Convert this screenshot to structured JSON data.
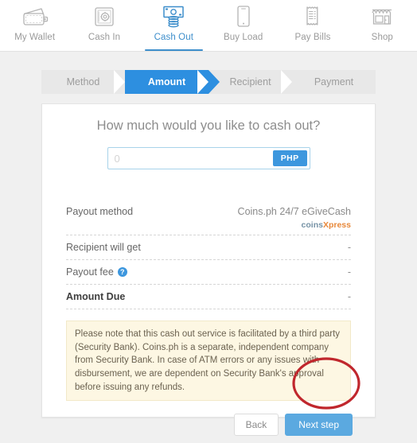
{
  "nav": {
    "items": [
      {
        "label": "My Wallet",
        "icon": "wallet-icon",
        "active": false
      },
      {
        "label": "Cash In",
        "icon": "safe-icon",
        "active": false
      },
      {
        "label": "Cash Out",
        "icon": "cash-out-icon",
        "active": true
      },
      {
        "label": "Buy Load",
        "icon": "mobile-phone-icon",
        "active": false
      },
      {
        "label": "Pay Bills",
        "icon": "receipt-icon",
        "active": false
      },
      {
        "label": "Shop",
        "icon": "storefront-icon",
        "active": false
      }
    ]
  },
  "steps": [
    {
      "label": "Method",
      "active": false
    },
    {
      "label": "Amount",
      "active": true
    },
    {
      "label": "Recipient",
      "active": false
    },
    {
      "label": "Payment",
      "active": false
    }
  ],
  "card": {
    "title": "How much would you like to cash out?",
    "amount_input": {
      "value": "",
      "placeholder": "0"
    },
    "currency_button": "PHP"
  },
  "details": {
    "payout_method": {
      "label": "Payout method",
      "value": "Coins.ph 24/7 eGiveCash",
      "brand_part1": "coins",
      "brand_part2": "Xpress"
    },
    "recipient_will_get": {
      "label": "Recipient will get",
      "value": "-"
    },
    "payout_fee": {
      "label": "Payout fee",
      "value": "-",
      "help_glyph": "?"
    },
    "amount_due": {
      "label": "Amount Due",
      "value": "-"
    }
  },
  "notice": "Please note that this cash out service is facilitated by a third party (Security Bank). Coins.ph is a separate, independent company from Security Bank. In case of ATM errors or any issues with disbursement, we are dependent on Security Bank's approval before issuing any refunds.",
  "actions": {
    "back": "Back",
    "next": "Next step"
  },
  "annotation": {
    "shape": "red-ellipse-highlight",
    "color": "#c0272d",
    "target": "Next step"
  },
  "colors": {
    "accent_blue": "#2d8fe0",
    "nav_active": "#3d8ecb",
    "notice_bg": "#fdf7e3",
    "brand_orange": "#e8883a",
    "annotation_red": "#c0272d"
  }
}
